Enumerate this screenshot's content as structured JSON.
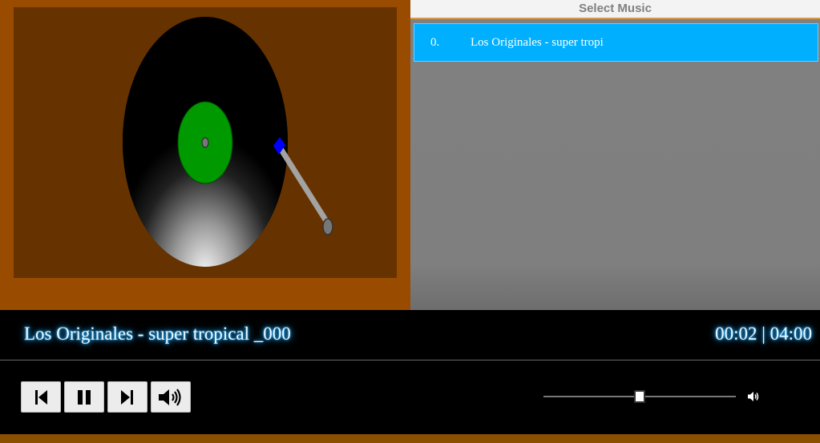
{
  "colors": {
    "turntable_frame": "#994c00",
    "turntable_deck": "#663300",
    "record": "#000000",
    "label": "#009900",
    "needle_head": "#0000ff",
    "playlist_bg": "#808080",
    "playlist_active": "#00b0ff",
    "glow": "#1aa6ff"
  },
  "playlist": {
    "header": "Select Music",
    "items": [
      {
        "index": "0.",
        "title": "Los Originales - super tropi"
      }
    ]
  },
  "player": {
    "track_title": "Los Originales - super tropical _000",
    "time_display": "00:02 | 04:00",
    "progress_fraction": 0.5
  },
  "controls": {
    "prev_icon": "skip-previous-icon",
    "pause_icon": "pause-icon",
    "next_icon": "skip-next-icon",
    "volume_icon": "volume-icon",
    "volume_small_icon": "volume-small-icon"
  }
}
